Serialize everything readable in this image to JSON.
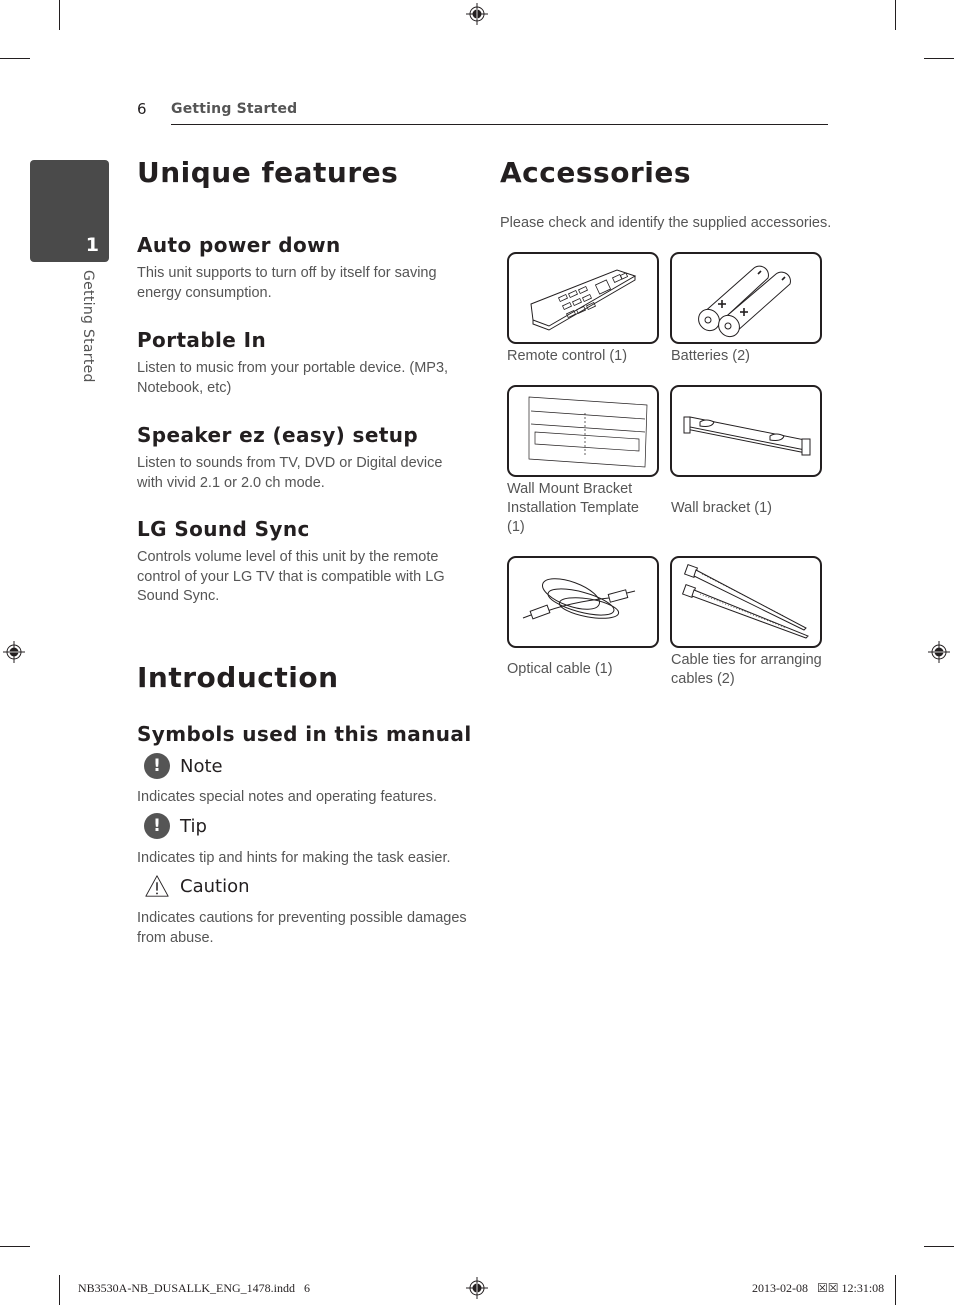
{
  "header": {
    "page_number": "6",
    "section_title": "Getting Started"
  },
  "side_tab": {
    "chapter_number": "1",
    "chapter_label": "Getting Started"
  },
  "unique_features": {
    "title": "Unique features",
    "items": [
      {
        "heading": "Auto power down",
        "text": "This unit supports to turn off by itself for saving energy consumption."
      },
      {
        "heading": "Portable In",
        "text": "Listen to music from your portable device. (MP3, Notebook, etc)"
      },
      {
        "heading": "Speaker ez (easy) setup",
        "text": "Listen to sounds from TV, DVD or Digital device with vivid 2.1 or 2.0 ch mode."
      },
      {
        "heading": "LG Sound Sync",
        "text": "Controls volume level of this unit by the remote control of your LG TV that is compatible with LG Sound Sync."
      }
    ]
  },
  "introduction": {
    "title": "Introduction",
    "subtitle": "Symbols used in this manual",
    "symbols": [
      {
        "icon": "exclamation-circle-icon",
        "label": "Note",
        "text": "Indicates special notes and operating features."
      },
      {
        "icon": "exclamation-circle-icon",
        "label": "Tip",
        "text": "Indicates tip and hints for making the task easier."
      },
      {
        "icon": "warning-triangle-icon",
        "label": "Caution",
        "text": "Indicates cautions for preventing possible damages from abuse."
      }
    ]
  },
  "accessories": {
    "title": "Accessories",
    "intro": "Please check and identify the supplied accessories.",
    "items": [
      {
        "icon": "remote-control-icon",
        "caption": "Remote control (1)"
      },
      {
        "icon": "batteries-icon",
        "caption": "Batteries (2)"
      },
      {
        "icon": "wall-mount-template-icon",
        "caption": "Wall Mount Bracket Installation Template (1)"
      },
      {
        "icon": "wall-bracket-icon",
        "caption": "Wall bracket (1)"
      },
      {
        "icon": "optical-cable-icon",
        "caption": "Optical cable (1)"
      },
      {
        "icon": "cable-ties-icon",
        "caption": "Cable ties for arranging cables (2)"
      }
    ]
  },
  "footer": {
    "file_slug": "NB3530A-NB_DUSALLK_ENG_1478.indd   6",
    "timestamp": "2013-02-08   ☒☒ 12:31:08"
  }
}
